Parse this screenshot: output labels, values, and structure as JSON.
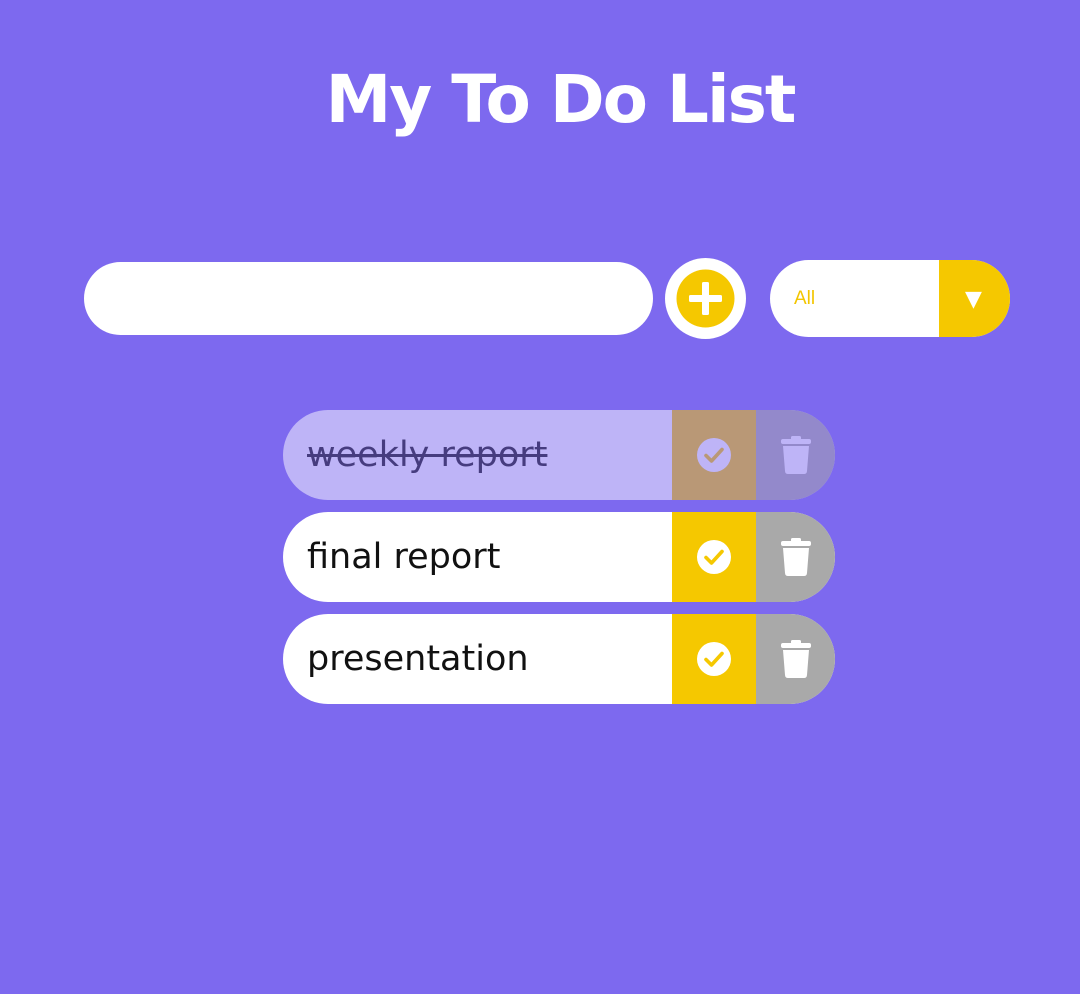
{
  "header": {
    "title": "My To Do List"
  },
  "form": {
    "input_value": "",
    "input_placeholder": "",
    "add_icon": "plus-circle-icon"
  },
  "filter": {
    "selected": "All",
    "arrow": "▼"
  },
  "todos": [
    {
      "text": "weekly report",
      "completed": true
    },
    {
      "text": "final report",
      "completed": false
    },
    {
      "text": "presentation",
      "completed": false
    }
  ],
  "icons": {
    "complete": "check-circle-icon",
    "delete": "trash-icon"
  },
  "colors": {
    "background": "#7d69ef",
    "accent": "#f5c800",
    "trash": "#a9a9a9",
    "white": "#ffffff"
  }
}
